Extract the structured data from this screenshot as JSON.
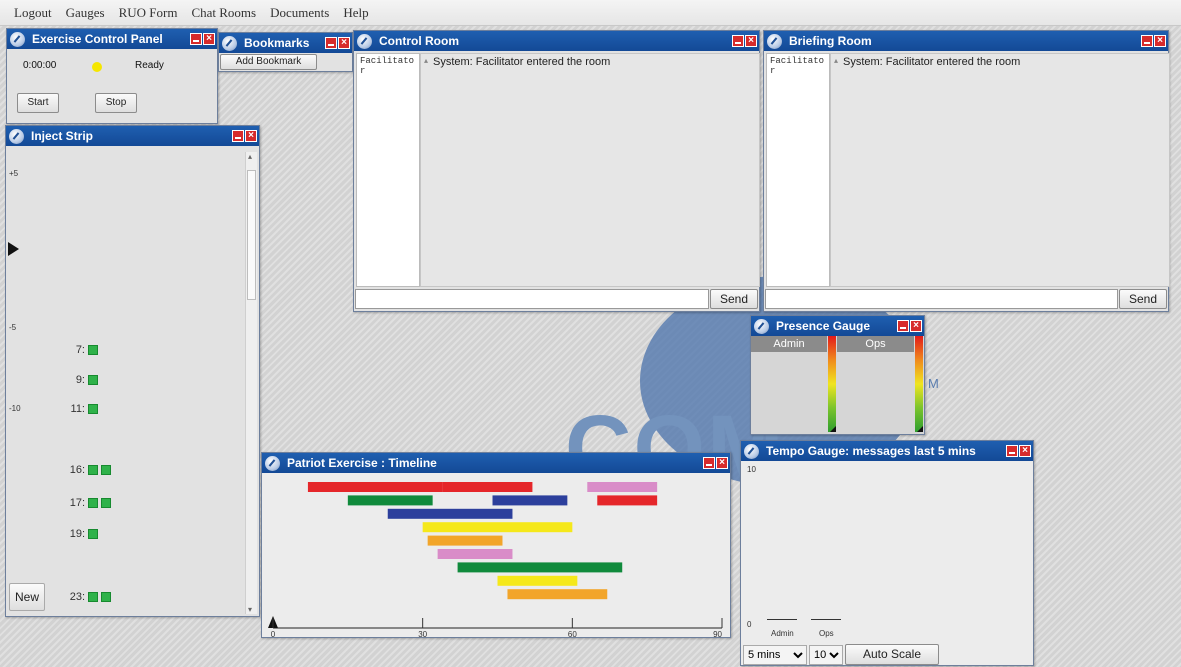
{
  "menubar": [
    "Logout",
    "Gauges",
    "RUO Form",
    "Chat Rooms",
    "Documents",
    "Help"
  ],
  "exercise_control": {
    "title": "Exercise Control Panel",
    "time": "0:00:00",
    "status": "Ready",
    "status_color": "#f5e600",
    "start_label": "Start",
    "stop_label": "Stop"
  },
  "bookmarks": {
    "title": "Bookmarks",
    "add_label": "Add Bookmark"
  },
  "control_room": {
    "title": "Control Room",
    "user": "Facilitator",
    "message": "System: Facilitator entered the room",
    "send_label": "Send"
  },
  "briefing_room": {
    "title": "Briefing Room",
    "user": "Facilitator",
    "message": "System: Facilitator entered the room",
    "send_label": "Send"
  },
  "inject_strip": {
    "title": "Inject Strip",
    "axis_labels": [
      "+5",
      "-5",
      "-10"
    ],
    "rows": [
      {
        "label": "7:",
        "count": 1
      },
      {
        "label": "9:",
        "count": 1
      },
      {
        "label": "11:",
        "count": 1
      },
      {
        "label": "16:",
        "count": 2
      },
      {
        "label": "17:",
        "count": 2
      },
      {
        "label": "19:",
        "count": 1
      },
      {
        "label": "23:",
        "count": 2
      }
    ],
    "new_label": "New"
  },
  "presence_gauge": {
    "title": "Presence Gauge",
    "columns": [
      "Admin",
      "Ops"
    ],
    "logo_m": "M"
  },
  "tempo_gauge": {
    "title": "Tempo Gauge: messages last 5 mins",
    "y_max": "10",
    "y_min": "0",
    "bars": [
      "Admin",
      "Ops"
    ],
    "window_value": "5 mins",
    "scale_value": "10",
    "autoscale_label": "Auto Scale"
  },
  "logo": {
    "text": "COM"
  },
  "timeline": {
    "title": "Patriot Exercise : Timeline",
    "colors": {
      "red": "#e5262a",
      "green": "#108a3c",
      "blue": "#2c3f9c",
      "yellow": "#f5e81a",
      "orange": "#f2a52a",
      "pink": "#d98cc8"
    }
  },
  "chart_data": {
    "type": "bar",
    "title": "Patriot Exercise : Timeline",
    "x_ticks": [
      "0",
      "30",
      "60",
      "90"
    ],
    "xlim": [
      0,
      90
    ],
    "bars": [
      {
        "color": "red",
        "start": 7,
        "end": 34
      },
      {
        "color": "red",
        "start": 34,
        "end": 52
      },
      {
        "color": "pink",
        "start": 63,
        "end": 77
      },
      {
        "color": "green",
        "start": 15,
        "end": 32
      },
      {
        "color": "blue",
        "start": 44,
        "end": 59
      },
      {
        "color": "red",
        "start": 65,
        "end": 77
      },
      {
        "color": "blue",
        "start": 23,
        "end": 48
      },
      {
        "color": "yellow",
        "start": 30,
        "end": 60
      },
      {
        "color": "orange",
        "start": 31,
        "end": 46
      },
      {
        "color": "pink",
        "start": 33,
        "end": 48
      },
      {
        "color": "green",
        "start": 37,
        "end": 70
      },
      {
        "color": "yellow",
        "start": 45,
        "end": 61
      },
      {
        "color": "orange",
        "start": 47,
        "end": 67
      }
    ]
  }
}
